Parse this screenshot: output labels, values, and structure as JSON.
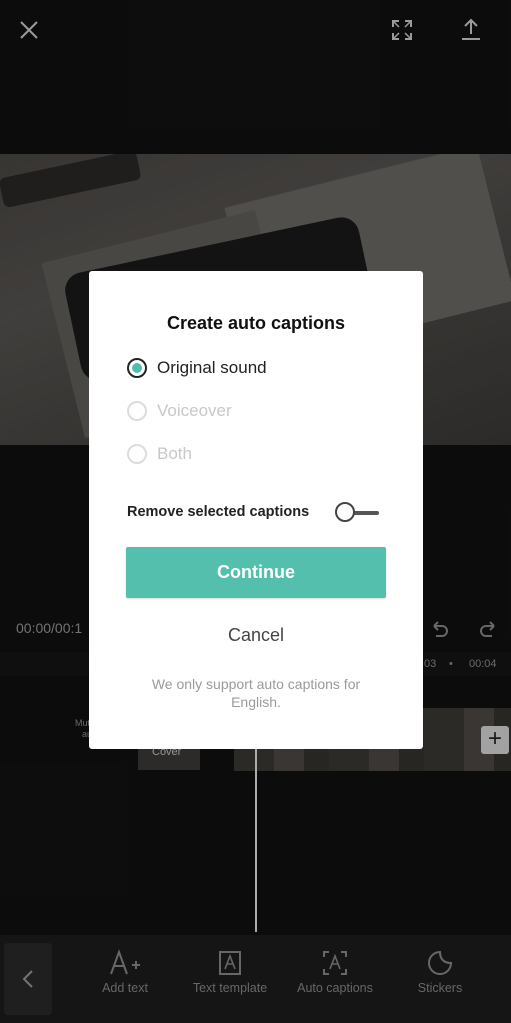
{
  "editor": {
    "timecode": "00:00/00:1",
    "ruler": [
      "03",
      "•",
      "00:04"
    ],
    "mute_label": "Mute clip audio",
    "cover_label": "Cover"
  },
  "toolbar": {
    "items": [
      {
        "label": "Add text",
        "icon": "add-text-icon"
      },
      {
        "label": "Text template",
        "icon": "text-template-icon"
      },
      {
        "label": "Auto captions",
        "icon": "auto-captions-icon"
      },
      {
        "label": "Stickers",
        "icon": "stickers-icon"
      }
    ]
  },
  "dialog": {
    "title": "Create auto captions",
    "options": [
      {
        "label": "Original sound",
        "selected": true,
        "enabled": true
      },
      {
        "label": "Voiceover",
        "selected": false,
        "enabled": false
      },
      {
        "label": "Both",
        "selected": false,
        "enabled": false
      }
    ],
    "remove_label": "Remove selected captions",
    "remove_enabled": false,
    "continue_label": "Continue",
    "cancel_label": "Cancel",
    "note": "We only support auto captions for English."
  },
  "colors": {
    "accent": "#55bfae",
    "radio_dot": "#4fbdae"
  }
}
